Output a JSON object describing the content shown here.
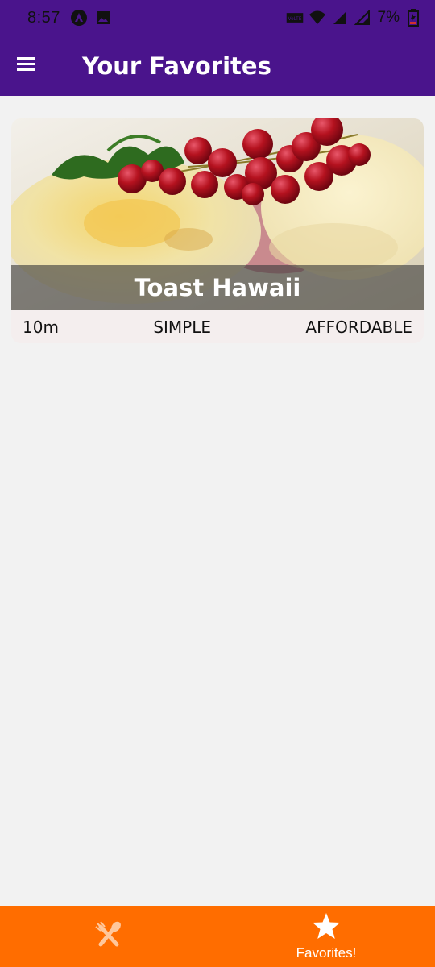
{
  "status_bar": {
    "time": "8:57",
    "battery": "7%",
    "icons_left": [
      "app-icon",
      "image-icon"
    ],
    "icons_right": [
      "volte-icon",
      "wifi-icon",
      "signal-icon",
      "signal-r-icon",
      "battery-icon"
    ]
  },
  "app_bar": {
    "title": "Your Favorites",
    "menu_icon": "menu-icon",
    "background": "#4a148c"
  },
  "favorites": [
    {
      "title": "Toast Hawaii",
      "duration": "10m",
      "complexity": "SIMPLE",
      "affordability": "AFFORDABLE"
    }
  ],
  "bottom_nav": {
    "background": "#ff6d00",
    "tabs": [
      {
        "icon": "restaurant-icon",
        "label": "",
        "active": false
      },
      {
        "icon": "star-icon",
        "label": "Favorites!",
        "active": true
      }
    ]
  }
}
